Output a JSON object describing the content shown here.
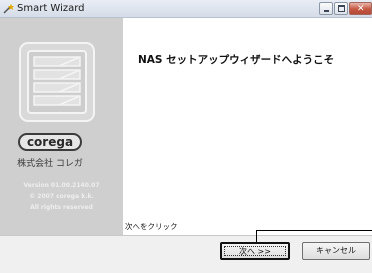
{
  "window": {
    "title": "Smart Wizard",
    "close_glyph": "✕"
  },
  "sidebar": {
    "logo_text": "corega",
    "company": "株式会社 コレガ",
    "version": "Version 01.00.2140.07",
    "copyright": "© 2007 corega k.k.",
    "rights": "All rights reserved"
  },
  "main": {
    "heading": "NAS セットアップウィザードへようこそ",
    "instruction": "次へをクリック"
  },
  "buttons": {
    "next": "次へ >>",
    "cancel": "キャンセル"
  },
  "icons": {
    "app": "wizard-icon",
    "device": "nas-device-icon",
    "minimize": "minimize-icon",
    "maximize": "maximize-icon",
    "close": "close-icon"
  }
}
